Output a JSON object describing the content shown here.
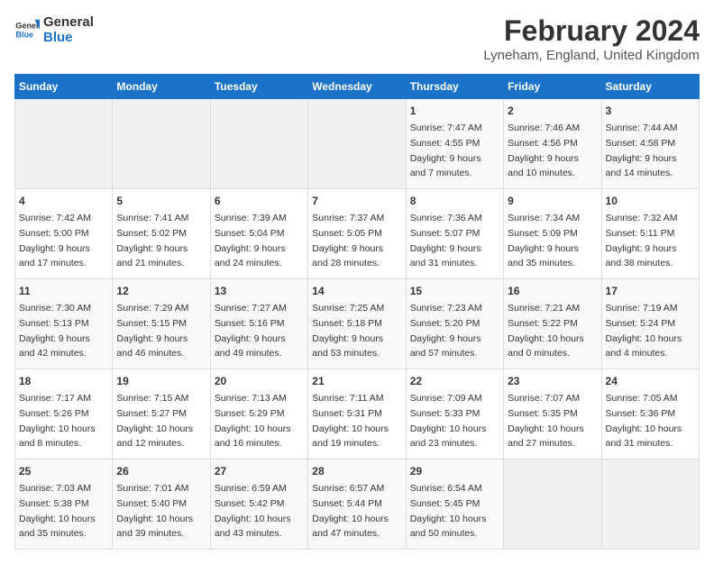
{
  "header": {
    "logo_line1": "General",
    "logo_line2": "Blue",
    "title": "February 2024",
    "subtitle": "Lyneham, England, United Kingdom"
  },
  "weekdays": [
    "Sunday",
    "Monday",
    "Tuesday",
    "Wednesday",
    "Thursday",
    "Friday",
    "Saturday"
  ],
  "weeks": [
    [
      {
        "day": "",
        "info": ""
      },
      {
        "day": "",
        "info": ""
      },
      {
        "day": "",
        "info": ""
      },
      {
        "day": "",
        "info": ""
      },
      {
        "day": "1",
        "info": "Sunrise: 7:47 AM\nSunset: 4:55 PM\nDaylight: 9 hours\nand 7 minutes."
      },
      {
        "day": "2",
        "info": "Sunrise: 7:46 AM\nSunset: 4:56 PM\nDaylight: 9 hours\nand 10 minutes."
      },
      {
        "day": "3",
        "info": "Sunrise: 7:44 AM\nSunset: 4:58 PM\nDaylight: 9 hours\nand 14 minutes."
      }
    ],
    [
      {
        "day": "4",
        "info": "Sunrise: 7:42 AM\nSunset: 5:00 PM\nDaylight: 9 hours\nand 17 minutes."
      },
      {
        "day": "5",
        "info": "Sunrise: 7:41 AM\nSunset: 5:02 PM\nDaylight: 9 hours\nand 21 minutes."
      },
      {
        "day": "6",
        "info": "Sunrise: 7:39 AM\nSunset: 5:04 PM\nDaylight: 9 hours\nand 24 minutes."
      },
      {
        "day": "7",
        "info": "Sunrise: 7:37 AM\nSunset: 5:05 PM\nDaylight: 9 hours\nand 28 minutes."
      },
      {
        "day": "8",
        "info": "Sunrise: 7:36 AM\nSunset: 5:07 PM\nDaylight: 9 hours\nand 31 minutes."
      },
      {
        "day": "9",
        "info": "Sunrise: 7:34 AM\nSunset: 5:09 PM\nDaylight: 9 hours\nand 35 minutes."
      },
      {
        "day": "10",
        "info": "Sunrise: 7:32 AM\nSunset: 5:11 PM\nDaylight: 9 hours\nand 38 minutes."
      }
    ],
    [
      {
        "day": "11",
        "info": "Sunrise: 7:30 AM\nSunset: 5:13 PM\nDaylight: 9 hours\nand 42 minutes."
      },
      {
        "day": "12",
        "info": "Sunrise: 7:29 AM\nSunset: 5:15 PM\nDaylight: 9 hours\nand 46 minutes."
      },
      {
        "day": "13",
        "info": "Sunrise: 7:27 AM\nSunset: 5:16 PM\nDaylight: 9 hours\nand 49 minutes."
      },
      {
        "day": "14",
        "info": "Sunrise: 7:25 AM\nSunset: 5:18 PM\nDaylight: 9 hours\nand 53 minutes."
      },
      {
        "day": "15",
        "info": "Sunrise: 7:23 AM\nSunset: 5:20 PM\nDaylight: 9 hours\nand 57 minutes."
      },
      {
        "day": "16",
        "info": "Sunrise: 7:21 AM\nSunset: 5:22 PM\nDaylight: 10 hours\nand 0 minutes."
      },
      {
        "day": "17",
        "info": "Sunrise: 7:19 AM\nSunset: 5:24 PM\nDaylight: 10 hours\nand 4 minutes."
      }
    ],
    [
      {
        "day": "18",
        "info": "Sunrise: 7:17 AM\nSunset: 5:26 PM\nDaylight: 10 hours\nand 8 minutes."
      },
      {
        "day": "19",
        "info": "Sunrise: 7:15 AM\nSunset: 5:27 PM\nDaylight: 10 hours\nand 12 minutes."
      },
      {
        "day": "20",
        "info": "Sunrise: 7:13 AM\nSunset: 5:29 PM\nDaylight: 10 hours\nand 16 minutes."
      },
      {
        "day": "21",
        "info": "Sunrise: 7:11 AM\nSunset: 5:31 PM\nDaylight: 10 hours\nand 19 minutes."
      },
      {
        "day": "22",
        "info": "Sunrise: 7:09 AM\nSunset: 5:33 PM\nDaylight: 10 hours\nand 23 minutes."
      },
      {
        "day": "23",
        "info": "Sunrise: 7:07 AM\nSunset: 5:35 PM\nDaylight: 10 hours\nand 27 minutes."
      },
      {
        "day": "24",
        "info": "Sunrise: 7:05 AM\nSunset: 5:36 PM\nDaylight: 10 hours\nand 31 minutes."
      }
    ],
    [
      {
        "day": "25",
        "info": "Sunrise: 7:03 AM\nSunset: 5:38 PM\nDaylight: 10 hours\nand 35 minutes."
      },
      {
        "day": "26",
        "info": "Sunrise: 7:01 AM\nSunset: 5:40 PM\nDaylight: 10 hours\nand 39 minutes."
      },
      {
        "day": "27",
        "info": "Sunrise: 6:59 AM\nSunset: 5:42 PM\nDaylight: 10 hours\nand 43 minutes."
      },
      {
        "day": "28",
        "info": "Sunrise: 6:57 AM\nSunset: 5:44 PM\nDaylight: 10 hours\nand 47 minutes."
      },
      {
        "day": "29",
        "info": "Sunrise: 6:54 AM\nSunset: 5:45 PM\nDaylight: 10 hours\nand 50 minutes."
      },
      {
        "day": "",
        "info": ""
      },
      {
        "day": "",
        "info": ""
      }
    ]
  ]
}
